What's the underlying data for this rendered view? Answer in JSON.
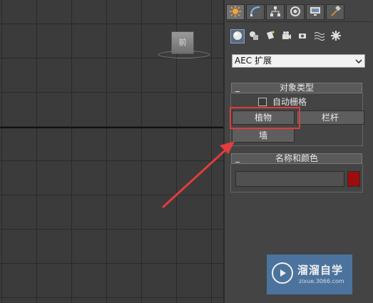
{
  "viewport": {
    "viewcube_label": "前"
  },
  "command_panel": {
    "tabs": [
      {
        "name": "create-tab",
        "icon": "create-sun-icon",
        "active": true
      },
      {
        "name": "modify-tab",
        "icon": "modify-arc-icon"
      },
      {
        "name": "hierarchy-tab",
        "icon": "hierarchy-icon"
      },
      {
        "name": "motion-tab",
        "icon": "motion-icon"
      },
      {
        "name": "display-tab",
        "icon": "display-monitor-icon"
      },
      {
        "name": "utilities-tab",
        "icon": "hammer-icon"
      }
    ],
    "categories": [
      {
        "name": "geometry",
        "icon": "sphere-icon",
        "active": true
      },
      {
        "name": "shapes",
        "icon": "shapes-icon"
      },
      {
        "name": "lights",
        "icon": "light-icon"
      },
      {
        "name": "cameras",
        "icon": "camera-icon"
      },
      {
        "name": "helpers",
        "icon": "helper-icon"
      },
      {
        "name": "space-warps",
        "icon": "wave-icon"
      },
      {
        "name": "systems",
        "icon": "gear-icon"
      }
    ],
    "dropdown": {
      "selected": "AEC 扩展"
    },
    "object_type": {
      "title": "对象类型",
      "collapse": "_",
      "autogrid_label": "自动栅格",
      "autogrid_checked": false,
      "buttons": {
        "foliage": "植物",
        "railing": "栏杆",
        "wall": "墙"
      }
    },
    "name_color": {
      "title": "名称和颜色",
      "collapse": "_",
      "name_value": "",
      "color": "#9c0d0d"
    }
  },
  "annotation": {
    "highlight_color": "#e23c3c"
  },
  "watermark": {
    "title": "溜溜自学",
    "url": "zixue.3066.com"
  }
}
